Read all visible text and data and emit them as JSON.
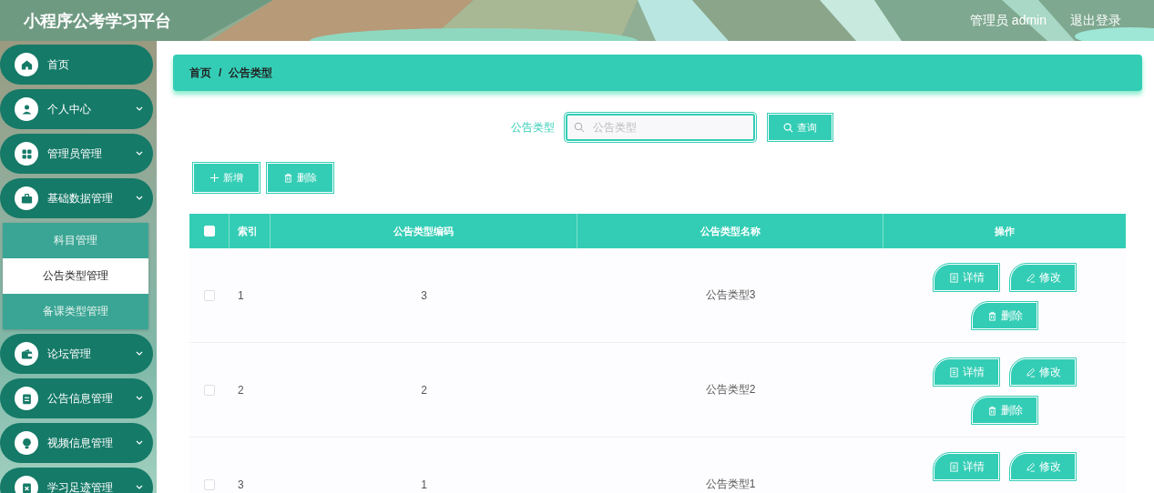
{
  "header": {
    "title": "小程序公考学习平台",
    "user": "管理员 admin",
    "logout": "退出登录"
  },
  "sidebar": {
    "items": [
      {
        "label": "首页",
        "expandable": false
      },
      {
        "label": "个人中心",
        "expandable": true
      },
      {
        "label": "管理员管理",
        "expandable": true
      },
      {
        "label": "基础数据管理",
        "expandable": true,
        "expanded": true,
        "children": [
          {
            "label": "科目管理",
            "selected": false
          },
          {
            "label": "公告类型管理",
            "selected": true
          },
          {
            "label": "备课类型管理",
            "selected": false
          }
        ]
      },
      {
        "label": "论坛管理",
        "expandable": true
      },
      {
        "label": "公告信息管理",
        "expandable": true
      },
      {
        "label": "视频信息管理",
        "expandable": true
      },
      {
        "label": "学习足迹管理",
        "expandable": true
      }
    ]
  },
  "breadcrumb": {
    "items": [
      "首页",
      "公告类型"
    ],
    "separator": "/"
  },
  "search": {
    "label": "公告类型",
    "placeholder": "公告类型",
    "button": "查询"
  },
  "toolbar": [
    {
      "kind": "add",
      "label": "新增"
    },
    {
      "kind": "delete",
      "label": "删除"
    }
  ],
  "table": {
    "select_all": {
      "checked": false
    },
    "columns": [
      "索引",
      "公告类型编码",
      "公告类型名称",
      "操作"
    ],
    "rows": [
      {
        "checked": false,
        "cells": [
          "1",
          "3",
          "公告类型3"
        ],
        "actions": [
          {
            "kind": "detail",
            "label": "详情"
          },
          {
            "kind": "edit",
            "label": "修改"
          },
          {
            "kind": "delete",
            "label": "删除"
          }
        ]
      },
      {
        "checked": false,
        "cells": [
          "2",
          "2",
          "公告类型2"
        ],
        "actions": [
          {
            "kind": "detail",
            "label": "详情"
          },
          {
            "kind": "edit",
            "label": "修改"
          },
          {
            "kind": "delete",
            "label": "删除"
          }
        ]
      },
      {
        "checked": false,
        "cells": [
          "3",
          "1",
          "公告类型1"
        ],
        "actions": [
          {
            "kind": "detail",
            "label": "详情"
          },
          {
            "kind": "edit",
            "label": "修改"
          }
        ]
      }
    ]
  }
}
